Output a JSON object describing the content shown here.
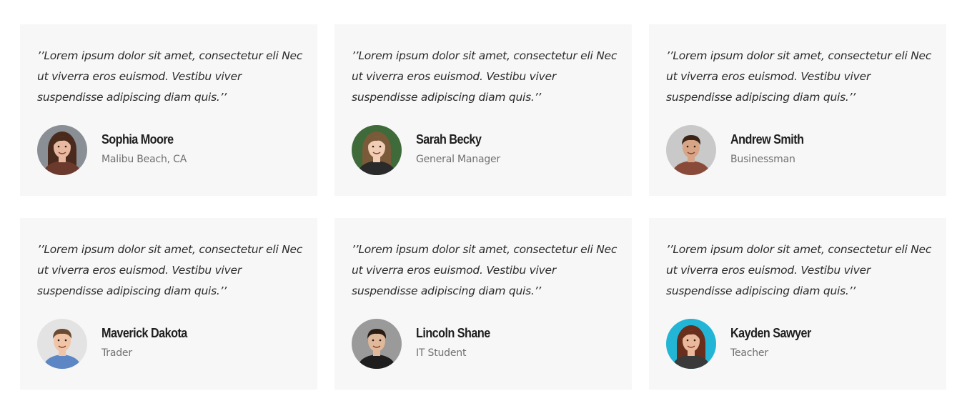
{
  "testimonials": [
    {
      "quote": "’’Lorem ipsum dolor sit amet, consectetur eli Nec ut viverra eros euismod. Vestibu viver suspendisse adipiscing diam quis.’’",
      "name": "Sophia Moore",
      "role": "Malibu Beach, CA",
      "avatar_icon": "woman-portrait-icon",
      "avatar_colors": {
        "bg": "#8a8f96",
        "hair": "#4a2a1c",
        "skin": "#e8b9a0",
        "shirt": "#6b3a2c"
      }
    },
    {
      "quote": "’’Lorem ipsum dolor sit amet, consectetur eli Nec ut viverra eros euismod. Vestibu viver suspendisse adipiscing diam quis.’’",
      "name": "Sarah Becky",
      "role": "General Manager",
      "avatar_icon": "woman-portrait-icon",
      "avatar_colors": {
        "bg": "#3f6a3a",
        "hair": "#7a5a38",
        "skin": "#f0cdb4",
        "shirt": "#2a2a2a"
      }
    },
    {
      "quote": "’’Lorem ipsum dolor sit amet, consectetur eli Nec ut viverra eros euismod. Vestibu viver suspendisse adipiscing diam quis.’’",
      "name": "Andrew Smith",
      "role": "Businessman",
      "avatar_icon": "man-portrait-icon",
      "avatar_colors": {
        "bg": "#c9c9c9",
        "hair": "#3a2418",
        "skin": "#d7a586",
        "shirt": "#8a4a3a"
      }
    },
    {
      "quote": "’’Lorem ipsum dolor sit amet, consectetur eli Nec ut viverra eros euismod. Vestibu viver suspendisse adipiscing diam quis.’’",
      "name": "Maverick Dakota",
      "role": "Trader",
      "avatar_icon": "man-portrait-icon",
      "avatar_colors": {
        "bg": "#e3e3e3",
        "hair": "#6a4a30",
        "skin": "#f0c4a6",
        "shirt": "#5d86c4"
      }
    },
    {
      "quote": "’’Lorem ipsum dolor sit amet, consectetur eli Nec ut viverra eros euismod. Vestibu viver suspendisse adipiscing diam quis.’’",
      "name": "Lincoln Shane",
      "role": "IT Student",
      "avatar_icon": "man-portrait-icon",
      "avatar_colors": {
        "bg": "#9a9a9a",
        "hair": "#2a1c14",
        "skin": "#e0b89a",
        "shirt": "#1e1e1e"
      }
    },
    {
      "quote": "’’Lorem ipsum dolor sit amet, consectetur eli Nec ut viverra eros euismod. Vestibu viver suspendisse adipiscing diam quis.’’",
      "name": "Kayden Sawyer",
      "role": "Teacher",
      "avatar_icon": "woman-portrait-icon",
      "avatar_colors": {
        "bg": "#22b5d6",
        "hair": "#6a2e1c",
        "skin": "#eab99c",
        "shirt": "#3a3a3a"
      }
    }
  ]
}
